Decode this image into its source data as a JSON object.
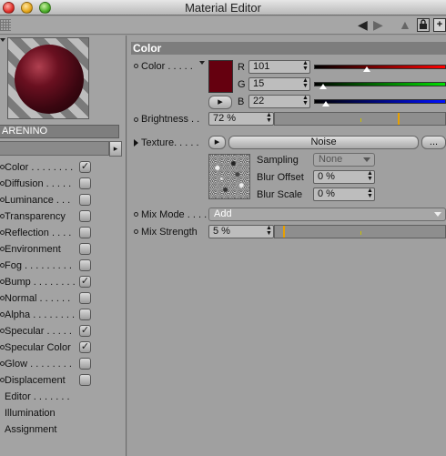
{
  "window": {
    "title": "Material Editor"
  },
  "toolbar": {
    "back_icon": "◀",
    "forward_icon": "▶",
    "up_icon": "▲",
    "lock_icon": "lock",
    "new_icon": "+"
  },
  "material": {
    "name": "ARENINO",
    "preview_color": "#65000f"
  },
  "channels": [
    {
      "label": "Color . . . . . . . .",
      "checked": "✓"
    },
    {
      "label": "Diffusion . . . . .",
      "checked": ""
    },
    {
      "label": "Luminance . . .",
      "checked": ""
    },
    {
      "label": "Transparency",
      "checked": ""
    },
    {
      "label": "Reflection . . . .",
      "checked": ""
    },
    {
      "label": "Environment",
      "checked": ""
    },
    {
      "label": "Fog . . . . . . . . .",
      "checked": ""
    },
    {
      "label": "Bump . . . . . . . .",
      "checked": "✓"
    },
    {
      "label": "Normal . . . . . .",
      "checked": ""
    },
    {
      "label": "Alpha . . . . . . . .",
      "checked": ""
    },
    {
      "label": "Specular . . . . .",
      "checked": "✓"
    },
    {
      "label": "Specular Color",
      "checked": "✓"
    },
    {
      "label": "Glow . . . . . . . .",
      "checked": ""
    },
    {
      "label": "Displacement",
      "checked": ""
    },
    {
      "label": "Editor . . . . . . .",
      "checked": null
    },
    {
      "label": "Illumination",
      "checked": null
    },
    {
      "label": "Assignment",
      "checked": null
    }
  ],
  "section": {
    "title": "Color"
  },
  "color": {
    "label": "Color . . . . .",
    "swatch": "#65000f",
    "r_label": "R",
    "r_value": "101",
    "r_fraction": 0.396,
    "g_label": "G",
    "g_value": "15",
    "g_fraction": 0.059,
    "b_label": "B",
    "b_value": "22",
    "b_fraction": 0.086
  },
  "brightness": {
    "label": "Brightness . .",
    "value": "72 %",
    "fraction": 0.72
  },
  "texture": {
    "label": "Texture. . . . .",
    "name": "Noise",
    "more": "...",
    "sampling_label": "Sampling",
    "sampling_value": "None",
    "blur_offset_label": "Blur Offset",
    "blur_offset_value": "0 %",
    "blur_scale_label": "Blur Scale",
    "blur_scale_value": "0 %"
  },
  "mix_mode": {
    "label": "Mix Mode . . . .",
    "value": "Add"
  },
  "mix_strength": {
    "label": "Mix Strength",
    "value": "5 %",
    "fraction": 0.05
  }
}
